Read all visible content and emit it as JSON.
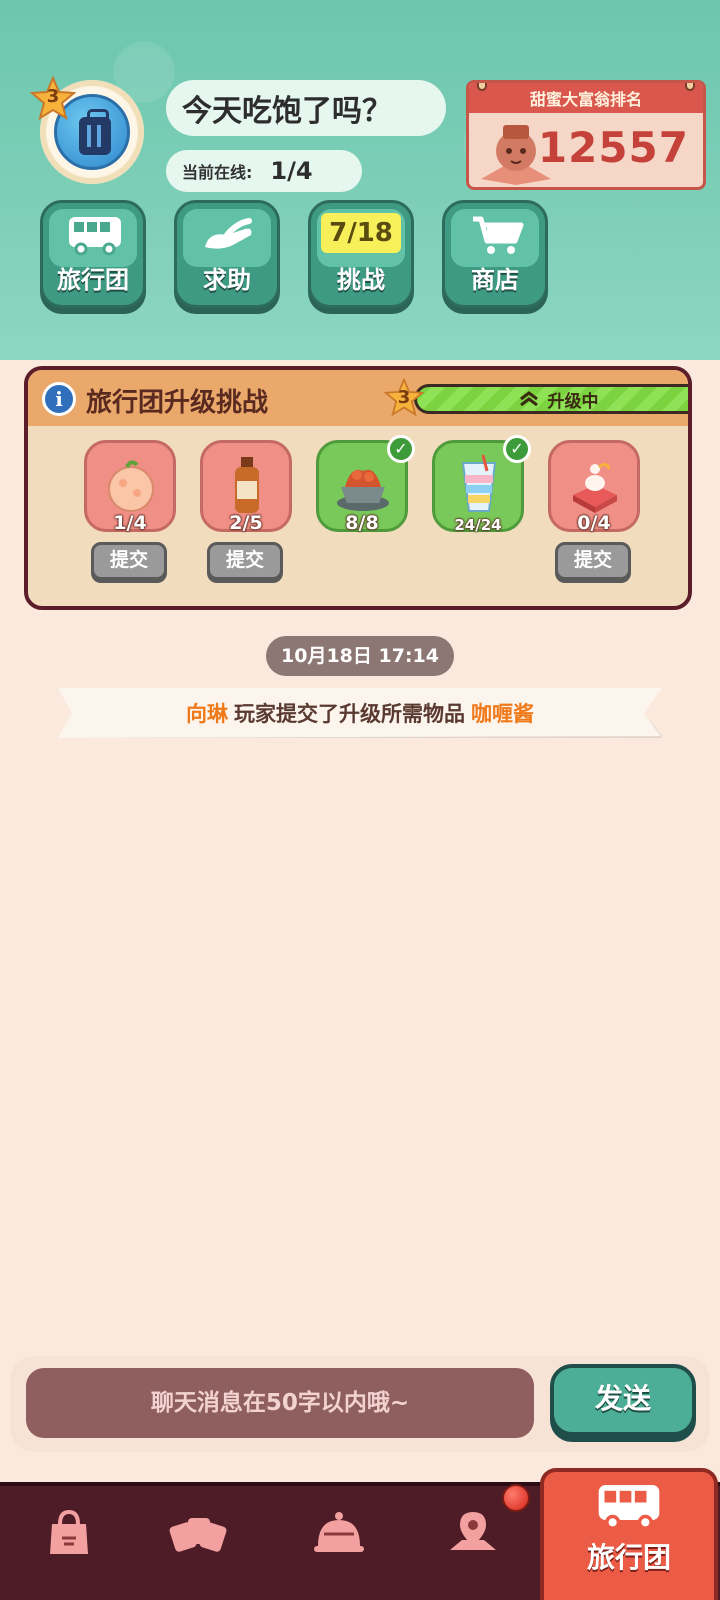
{
  "header": {
    "level": "3",
    "title": "今天吃饱了吗？",
    "online_label": "当前在线:",
    "online_value": "1/4",
    "ranking": {
      "title": "甜蜜大富翁排名",
      "value": "12557"
    }
  },
  "nav": [
    {
      "label": "旅行团",
      "icon": "bus-icon"
    },
    {
      "label": "求助",
      "icon": "helping-hand-icon"
    },
    {
      "label": "挑战",
      "badge": "7/18"
    },
    {
      "label": "商店",
      "icon": "cart-icon"
    }
  ],
  "challenge": {
    "title": "旅行团升级挑战",
    "level": "3",
    "status": "升级中",
    "submit_label": "提交",
    "items": [
      {
        "count": "1/4",
        "icon": "rice-ball-icon",
        "done": false
      },
      {
        "count": "2/5",
        "icon": "sauce-bottle-icon",
        "done": false
      },
      {
        "count": "8/8",
        "icon": "dessert-bowl-icon",
        "done": true
      },
      {
        "count": "24/24",
        "icon": "parfait-icon",
        "done": true
      },
      {
        "count": "0/4",
        "icon": "cake-stand-icon",
        "done": false
      }
    ]
  },
  "feed": {
    "timestamp": "10月18日 17:14",
    "notice": {
      "player": "向琳",
      "text": "玩家提交了升级所需物品",
      "item": "咖喱酱"
    }
  },
  "chat": {
    "placeholder": "聊天消息在50字以内哦~",
    "send_label": "发送"
  },
  "tabbar": {
    "tabs": [
      {
        "icon": "shopping-bag-icon"
      },
      {
        "icon": "cards-icon"
      },
      {
        "icon": "cloche-icon"
      },
      {
        "icon": "map-pin-icon"
      }
    ],
    "active_label": "旅行团",
    "active_icon": "bus-icon"
  },
  "colors": {
    "header_teal": "#7fcfb8",
    "panel_border": "#5c1d2a",
    "accent_orange": "#f07a1a",
    "tab_active": "#ec5b45"
  }
}
